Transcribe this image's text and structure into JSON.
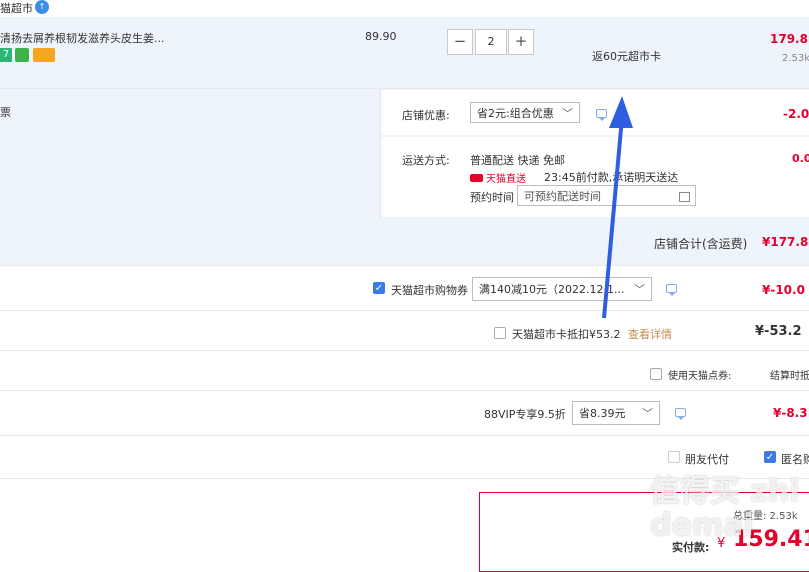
{
  "store": {
    "name": "猫超市",
    "badge": "↑"
  },
  "item": {
    "title": "清扬去屑养根韧发滋养头皮生姜...",
    "price": "89.90",
    "quantity": "2",
    "minus": "−",
    "plus": "+",
    "rebate": "返60元超市卡",
    "total": "179.8",
    "weight": "2.53k"
  },
  "invoice": {
    "label": "票"
  },
  "shop_discount": {
    "label": "店铺优惠:",
    "value": "省2元:组合优惠",
    "amount": "-2.0"
  },
  "delivery": {
    "label": "运送方式:",
    "method": "普通配送 快递 免邮",
    "badge": "天猫直送",
    "promise": "23:45前付款,承诺明天送达",
    "fee": "0.0",
    "reserve_label": "预约时间",
    "reserve_placeholder": "可预约配送时间"
  },
  "shop_total": {
    "label": "店铺合计(含运费)",
    "value": "¥177.8"
  },
  "coupon": {
    "label": "天猫超市购物券",
    "value": "满140减10元（2022.12.1...",
    "amount": "¥-10.0"
  },
  "card": {
    "label": "天猫超市卡抵扣¥53.2",
    "link": "查看详情",
    "amount": "¥-53.2"
  },
  "points": {
    "label": "使用天猫点券:",
    "right": "结算时抵"
  },
  "vip": {
    "label": "88VIP专享9.5折",
    "value": "省8.39元",
    "amount": "¥-8.3"
  },
  "options": {
    "friend_pay": "朋友代付",
    "anonymous": "匿名购"
  },
  "summary": {
    "weight": "总重量: 2.53k",
    "pay_label": "实付款:",
    "currency": "¥",
    "pay_value": "159.41"
  },
  "watermark": "值得买 zhidemai",
  "colors": {
    "accent_red": "#e4002b",
    "check_blue": "#3b7be8",
    "highlight_bg": "#eef4fb",
    "arrow": "#2f5fe0"
  }
}
